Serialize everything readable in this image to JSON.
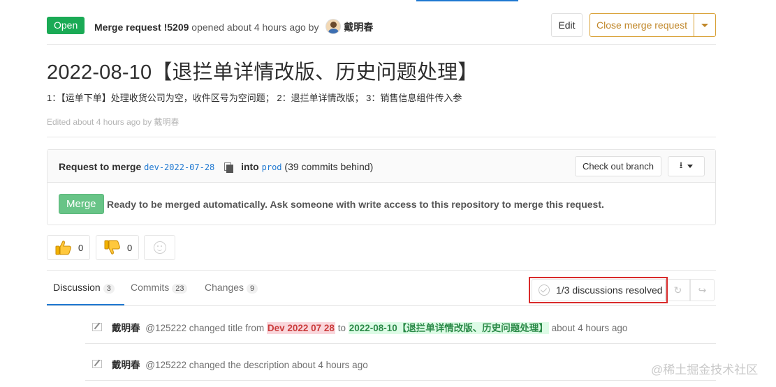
{
  "header": {
    "status_badge": "Open",
    "mr_ref": "Merge request !5209",
    "opened_text": "opened about 4 hours ago by",
    "author": "戴明春",
    "edit_label": "Edit",
    "close_label": "Close merge request"
  },
  "mr": {
    "title": "2022-08-10【退拦单详情改版、历史问题处理】",
    "description": "1：【运单下单】处理收货公司为空，收件区号为空问题； 2：退拦单详情改版； 3：销售信息组件传入参",
    "edited_prefix": "Edited about 4 hours ago by",
    "edited_by": "戴明春"
  },
  "widget": {
    "request_label": "Request to merge",
    "source_branch": "dev-2022-07-28",
    "into_label": "into",
    "target_branch": "prod",
    "behind_text": "(39 commits behind)",
    "checkout_label": "Check out branch",
    "merge_label": "Merge",
    "status_text": "Ready to be merged automatically. Ask someone with write access to this repository to merge this request."
  },
  "awards": {
    "thumbsup_count": "0",
    "thumbsdown_count": "0"
  },
  "tabs": [
    {
      "label": "Discussion",
      "count": "3"
    },
    {
      "label": "Commits",
      "count": "23"
    },
    {
      "label": "Changes",
      "count": "9"
    }
  ],
  "discussions": {
    "resolved_text": "1/3 discussions resolved"
  },
  "notes": [
    {
      "author": "戴明春",
      "handle_action": "@125222 changed title from",
      "old_value": "Dev 2022 07 28",
      "to_text": "to",
      "new_value": "2022-08-10【退拦单详情改版、历史问题处理】",
      "time": "about 4 hours ago"
    },
    {
      "author": "戴明春",
      "handle_action": "@125222 changed the description about 4 hours ago"
    }
  ],
  "watermark": "@稀土掘金技术社区",
  "colors": {
    "open_green": "#1aaa55",
    "close_orange": "#d8a034",
    "merge_green": "#68c487",
    "link_blue": "#1f78d1",
    "highlight_red": "#d92b2b"
  }
}
